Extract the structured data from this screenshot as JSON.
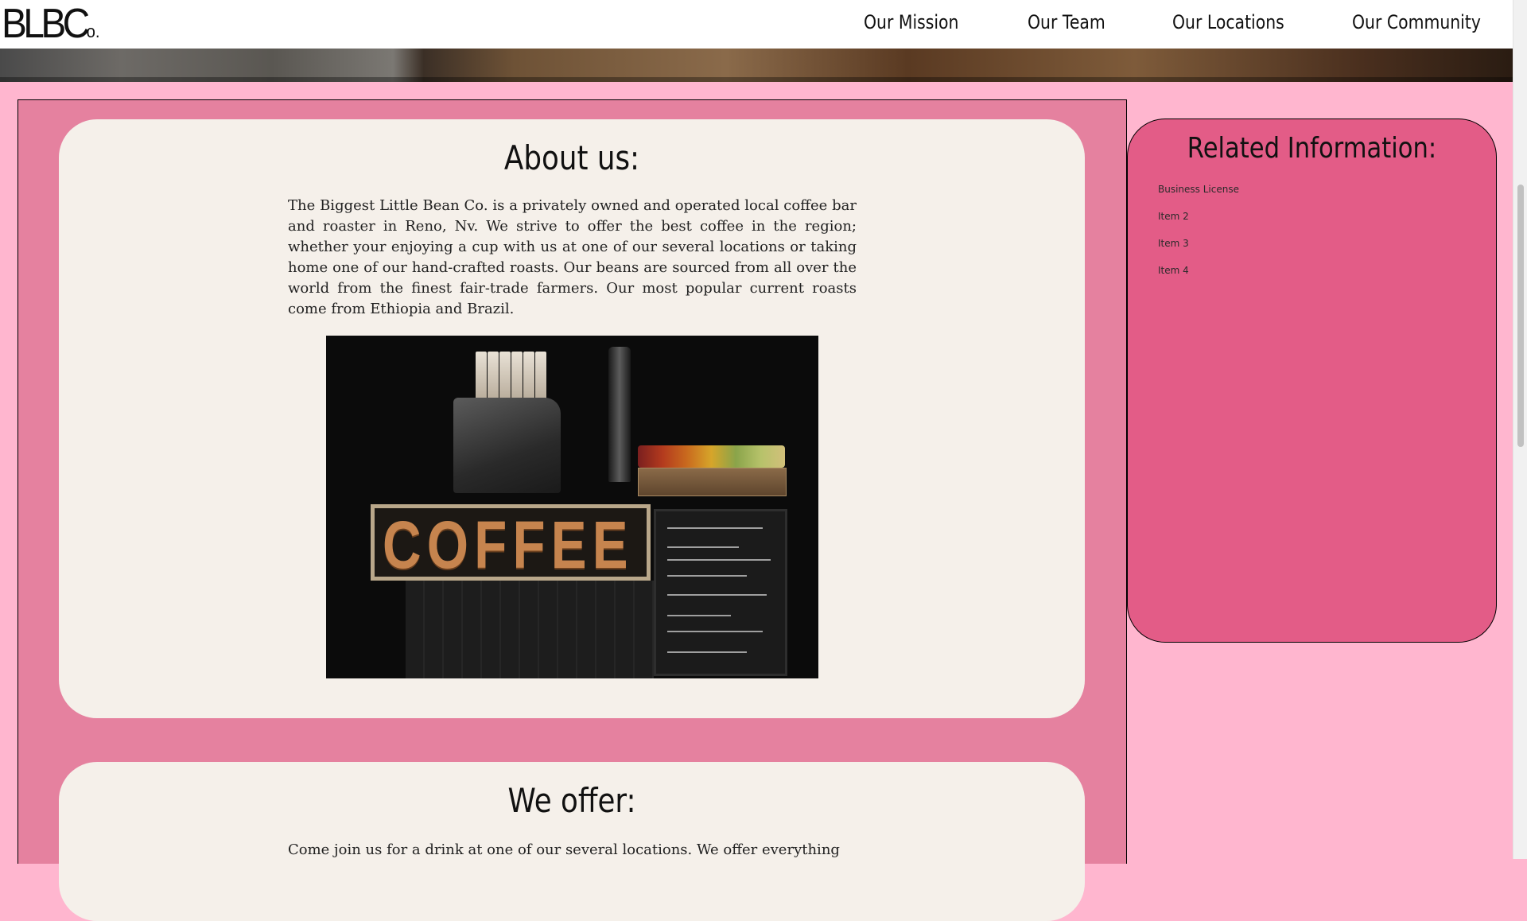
{
  "header": {
    "logo_main": "BLBC",
    "logo_suffix": "o.",
    "nav": [
      "Our Mission",
      "Our Team",
      "Our Locations",
      "Our Community"
    ]
  },
  "about": {
    "title": "About us:",
    "text": "The Biggest Little Bean Co. is a privately owned and operated local coffee bar and roaster in Reno, Nv. We strive to offer the best coffee in the region; whether your enjoying a cup with us at one of our several locations or taking home one of our hand-crafted roasts. Our beans are sourced from all over the world from the finest fair-trade farmers. Our most popular current roasts come from Ethiopia and Brazil.",
    "photo_sign": "COFFEE"
  },
  "offer": {
    "title": "We offer:",
    "text": "Come join us for a drink at one of our several locations. We offer everything"
  },
  "sidebar": {
    "title": "Related Information:",
    "items": [
      "Business License",
      "Item 2",
      "Item 3",
      "Item 4"
    ]
  },
  "colors": {
    "page_bg": "#ffb6cf",
    "main_bg": "#e5819f",
    "card_bg": "#f5f0ea",
    "sidebar_bg": "#e35c87"
  }
}
